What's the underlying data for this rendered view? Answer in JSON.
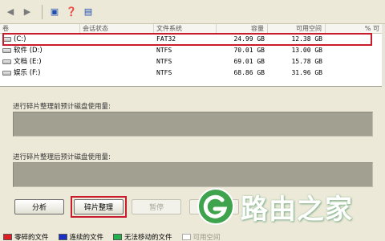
{
  "toolbar": {
    "buttons": [
      "back-arrow",
      "forward-arrow",
      "view-properties",
      "help",
      "details"
    ]
  },
  "volume_list": {
    "columns": [
      "卷",
      "会话状态",
      "文件系统",
      "容量",
      "可用空间",
      "% 可"
    ],
    "rows": [
      {
        "volume": "(C:)",
        "status": "",
        "fs": "FAT32",
        "capacity": "24.99 GB",
        "free": "12.38 GB",
        "pct": ""
      },
      {
        "volume": "软件 (D:)",
        "status": "",
        "fs": "NTFS",
        "capacity": "70.01 GB",
        "free": "13.00 GB",
        "pct": ""
      },
      {
        "volume": "文档 (E:)",
        "status": "",
        "fs": "NTFS",
        "capacity": "69.01 GB",
        "free": "15.78 GB",
        "pct": ""
      },
      {
        "volume": "娱乐 (F:)",
        "status": "",
        "fs": "NTFS",
        "capacity": "68.86 GB",
        "free": "31.96 GB",
        "pct": ""
      }
    ]
  },
  "before_label": "进行碎片整理前预计磁盘使用量:",
  "after_label": "进行碎片整理后预计磁盘使用量:",
  "buttons": {
    "analyze": "分析",
    "defrag": "碎片整理",
    "pause": "暂停",
    "stop": "停止"
  },
  "legend": {
    "fragmented": "零碎的文件",
    "contiguous": "连续的文件",
    "unmovable": "无法移动的文件",
    "free": "可用空间"
  },
  "colors": {
    "fragmented": "#e31b23",
    "contiguous": "#1a2fc4",
    "unmovable": "#22b14c",
    "free": "#ffffff",
    "highlight": "#c81b2b"
  },
  "watermark": {
    "text": "路由之家"
  }
}
